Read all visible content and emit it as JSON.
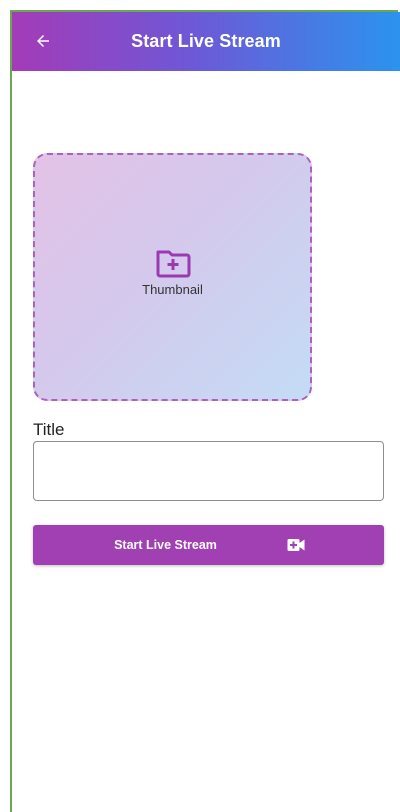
{
  "appbar": {
    "title": "Start Live Stream",
    "back_icon": "arrow-left-icon",
    "gradient": [
      "#a43bb7",
      "#2b93ee"
    ]
  },
  "thumbnail": {
    "label": "Thumbnail",
    "icon": "folder-plus-icon",
    "border_color": "#b15fbe"
  },
  "form": {
    "title_label": "Title",
    "title_value": "",
    "title_placeholder": ""
  },
  "start_button": {
    "label": "Start Live Stream",
    "icon": "video-camera-plus-icon",
    "color": "#a040b3"
  }
}
